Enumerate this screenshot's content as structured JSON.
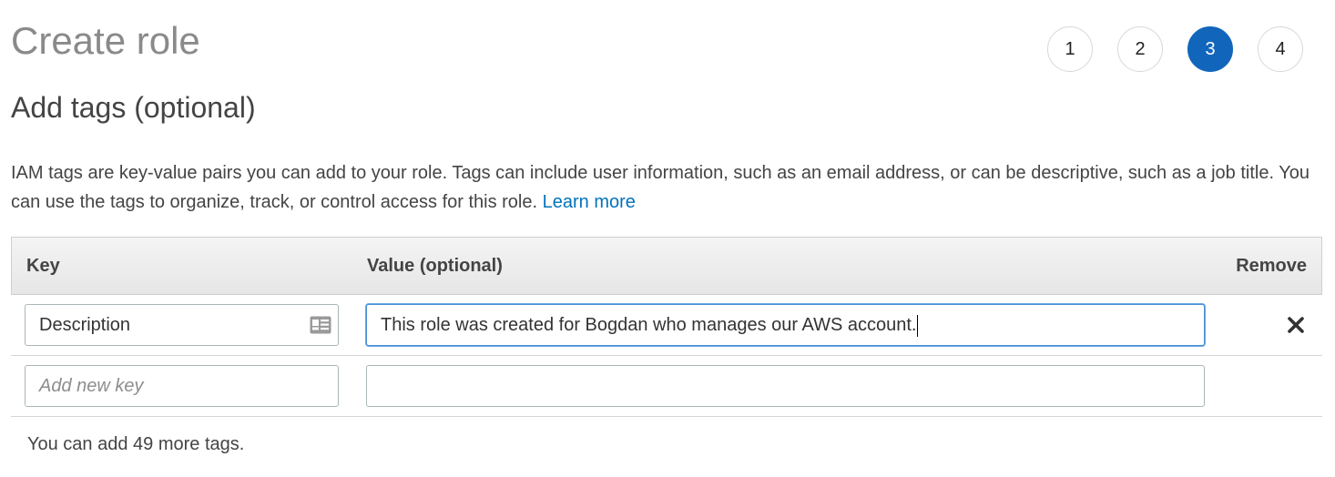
{
  "page": {
    "title": "Create role"
  },
  "steps": [
    {
      "label": "1",
      "active": false
    },
    {
      "label": "2",
      "active": false
    },
    {
      "label": "3",
      "active": true
    },
    {
      "label": "4",
      "active": false
    }
  ],
  "section": {
    "title": "Add tags (optional)",
    "description": "IAM tags are key-value pairs you can add to your role. Tags can include user information, such as an email address, or can be descriptive, such as a job title. You can use the tags to organize, track, or control access for this role.",
    "learn_more": "Learn more"
  },
  "table": {
    "headers": {
      "key": "Key",
      "value": "Value (optional)",
      "remove": "Remove"
    },
    "rows": [
      {
        "key": "Description",
        "value": "This role was created for Bogdan who manages our AWS account."
      }
    ],
    "new_row": {
      "key_placeholder": "Add new key",
      "value": ""
    }
  },
  "footer": {
    "remaining": "You can add 49 more tags."
  },
  "colors": {
    "accent": "#1166bb",
    "link": "#0073bb",
    "focus_border": "#4a8fd6"
  },
  "icons": {
    "key_field_icon": "contact-card-icon",
    "remove_icon": "close-icon"
  }
}
